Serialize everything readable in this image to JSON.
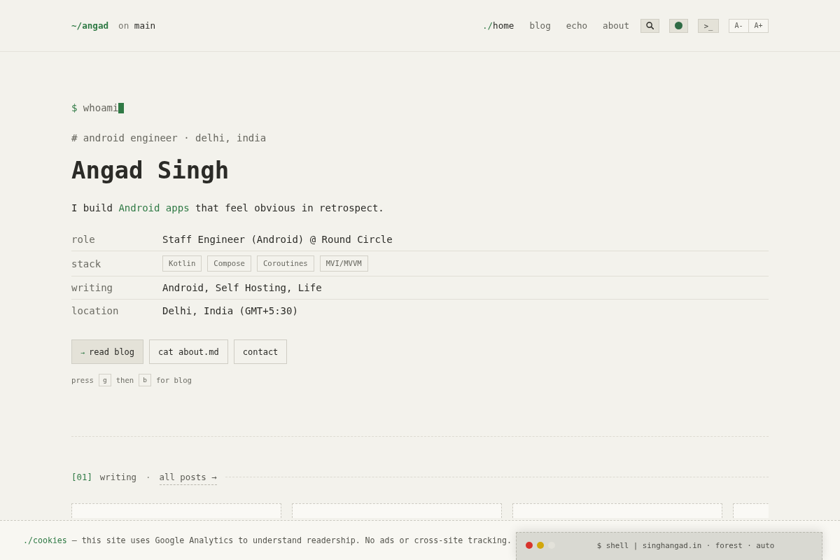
{
  "header": {
    "brand": "~/angad",
    "branch": {
      "prefix": "on",
      "name": "main"
    },
    "nav": [
      {
        "prefix": "./",
        "label": "home",
        "selected": true
      },
      {
        "label": "blog",
        "selected": false
      },
      {
        "label": "echo",
        "selected": false
      },
      {
        "label": "about",
        "selected": false
      }
    ],
    "tools": [
      {
        "kind": "search"
      },
      {
        "kind": "theme"
      },
      {
        "kind": "shell",
        "label": ">_"
      }
    ],
    "font_size": [
      "A-",
      "A+"
    ]
  },
  "hero": {
    "prompt": "$",
    "command": "whoami",
    "tagline": "# android engineer · delhi, india",
    "name": "Angad Singh",
    "intro": {
      "before": "I build ",
      "link": "Android apps",
      "after": " that feel obvious in retrospect."
    }
  },
  "profile": [
    {
      "key": "role",
      "kind": "text",
      "value": "Staff Engineer (Android) @ Round Circle"
    },
    {
      "key": "stack",
      "kind": "tags",
      "tags": [
        "Kotlin",
        "Compose",
        "Coroutines",
        "MVI/MVVM"
      ]
    },
    {
      "key": "writing",
      "kind": "text",
      "value": "Android, Self Hosting, Life"
    },
    {
      "key": "location",
      "kind": "text",
      "value": "Delhi, India (GMT+5:30)"
    }
  ],
  "actions": [
    {
      "icon": "→",
      "label": "read blog",
      "primary": true
    },
    {
      "label": "cat about.md",
      "primary": false
    },
    {
      "label": "contact",
      "primary": false
    }
  ],
  "hint": [
    {
      "kind": "text",
      "text": "press"
    },
    {
      "kind": "key",
      "text": "g"
    },
    {
      "kind": "text",
      "text": "then"
    },
    {
      "kind": "key",
      "text": "b"
    },
    {
      "kind": "text",
      "text": "for blog"
    }
  ],
  "writing": {
    "index": "[01]",
    "title": "writing",
    "separator": "·",
    "link": "all posts →"
  },
  "cookie_notice": {
    "label": "./cookies",
    "text": "— this site uses Google Analytics to understand readership. No ads or cross-site tracking."
  },
  "shell": {
    "title": "$ shell | singhangad.in · forest · auto"
  }
}
